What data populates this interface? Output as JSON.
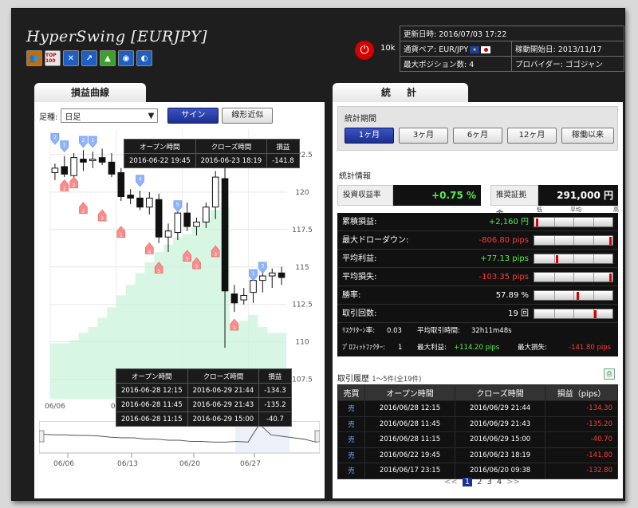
{
  "app": {
    "title": "HyperSwing [EURJPY]"
  },
  "header_icons": [
    {
      "name": "people-icon",
      "glyph": "👥",
      "color": "#c86c00"
    },
    {
      "name": "top100-icon",
      "glyph": "TOP 100",
      "color": "#e8e8e8"
    },
    {
      "name": "shuffle-icon",
      "glyph": "✕",
      "color": "#1e5fc4"
    },
    {
      "name": "chart-up-icon",
      "glyph": "↗",
      "color": "#1e5fc4"
    },
    {
      "name": "tree-icon",
      "glyph": "▲",
      "color": "#3aa12c"
    },
    {
      "name": "dial-icon",
      "glyph": "◉",
      "color": "#1e5fc4"
    },
    {
      "name": "globe-icon",
      "glyph": "◐",
      "color": "#1e5fc4"
    }
  ],
  "account": {
    "capital": "10k"
  },
  "info": {
    "updated_label": "更新日時:",
    "updated_value": "2016/07/03 17:22",
    "pair_label": "通貨ペア:",
    "pair_value": "EUR/JPY",
    "start_label": "稼動開始日:",
    "start_value": "2013/11/17",
    "maxpos_label": "最大ポジション数:",
    "maxpos_value": "4",
    "provider_label": "プロバイダー:",
    "provider_value": "ゴゴジャン"
  },
  "left": {
    "tab": "損益曲線",
    "period_label": "足種:",
    "period_value": "日足",
    "sign_button": "サイン",
    "trend_button": "線形近似",
    "tooltip_top": {
      "h1": "オープン時間",
      "h2": "クローズ時間",
      "h3": "損益",
      "open": "2016-06-22 19:45",
      "close": "2016-06-23 18:19",
      "pl": "-141.8"
    },
    "tooltip_bottom": {
      "h1": "オープン時間",
      "h2": "クローズ時間",
      "h3": "損益",
      "rows": [
        {
          "open": "2016-06-28 12:15",
          "close": "2016-06-29 21:44",
          "pl": "-134.3"
        },
        {
          "open": "2016-06-28 11:45",
          "close": "2016-06-29 21:43",
          "pl": "-135.2"
        },
        {
          "open": "2016-06-28 11:15",
          "close": "2016-06-29 15:00",
          "pl": "-40.7"
        }
      ]
    }
  },
  "chart_data": {
    "type": "candlestick",
    "title": "",
    "x_labels": [
      "06/06",
      "06/13",
      "06/20",
      "06/27"
    ],
    "y_ticks": [
      107.5,
      110,
      112.5,
      115,
      117.5,
      120,
      122.5
    ],
    "ylim": [
      106.2,
      124.2
    ],
    "grid": true,
    "candles": [
      {
        "o": 121.3,
        "h": 121.9,
        "l": 120.8,
        "c": 121.6
      },
      {
        "o": 121.7,
        "h": 122.4,
        "l": 121.0,
        "c": 121.2
      },
      {
        "o": 121.1,
        "h": 122.6,
        "l": 120.5,
        "c": 122.3
      },
      {
        "o": 122.2,
        "h": 122.8,
        "l": 121.4,
        "c": 122.0
      },
      {
        "o": 122.1,
        "h": 122.7,
        "l": 121.6,
        "c": 122.2
      },
      {
        "o": 122.3,
        "h": 122.9,
        "l": 121.8,
        "c": 122.0
      },
      {
        "o": 122.0,
        "h": 122.6,
        "l": 121.0,
        "c": 121.2
      },
      {
        "o": 121.3,
        "h": 121.6,
        "l": 119.4,
        "c": 119.7
      },
      {
        "o": 119.8,
        "h": 120.2,
        "l": 119.2,
        "c": 119.6
      },
      {
        "o": 119.6,
        "h": 120.1,
        "l": 118.8,
        "c": 119.0
      },
      {
        "o": 119.0,
        "h": 120.0,
        "l": 118.5,
        "c": 119.6
      },
      {
        "o": 119.5,
        "h": 119.9,
        "l": 116.6,
        "c": 117.0
      },
      {
        "o": 117.0,
        "h": 117.9,
        "l": 116.0,
        "c": 117.4
      },
      {
        "o": 117.3,
        "h": 118.8,
        "l": 116.8,
        "c": 118.6
      },
      {
        "o": 118.6,
        "h": 119.3,
        "l": 117.4,
        "c": 117.7
      },
      {
        "o": 117.7,
        "h": 118.3,
        "l": 117.1,
        "c": 118.0
      },
      {
        "o": 118.0,
        "h": 119.3,
        "l": 117.6,
        "c": 119.0
      },
      {
        "o": 119.0,
        "h": 121.4,
        "l": 118.2,
        "c": 121.0
      },
      {
        "o": 120.9,
        "h": 121.9,
        "l": 109.6,
        "c": 113.4
      },
      {
        "o": 113.2,
        "h": 113.8,
        "l": 112.0,
        "c": 112.6
      },
      {
        "o": 112.8,
        "h": 113.6,
        "l": 112.5,
        "c": 113.1
      },
      {
        "o": 113.3,
        "h": 114.4,
        "l": 112.6,
        "c": 114.1
      },
      {
        "o": 114.1,
        "h": 115.0,
        "l": 113.3,
        "c": 114.4
      },
      {
        "o": 114.4,
        "h": 114.9,
        "l": 113.6,
        "c": 114.6
      },
      {
        "o": 114.6,
        "h": 115.0,
        "l": 113.8,
        "c": 114.3
      }
    ],
    "equity_area_top": [
      109.9,
      109.9,
      110.1,
      110.6,
      111.0,
      111.6,
      112.3,
      113.1,
      113.8,
      114.6,
      115.3,
      116.0,
      116.5,
      117.0,
      117.2,
      117.6,
      118.3,
      118.8,
      119.0,
      111.2,
      111.4,
      111.8,
      111.0,
      110.6,
      110.6
    ],
    "signals": [
      {
        "i": 0,
        "y": 123.5,
        "kind": "buy",
        "label": "2"
      },
      {
        "i": 1,
        "y": 123.0,
        "kind": "buy",
        "label": "1"
      },
      {
        "i": 3,
        "y": 123.3,
        "kind": "buy",
        "label": "2"
      },
      {
        "i": 4,
        "y": 123.3,
        "kind": "buy",
        "label": "1"
      },
      {
        "i": 1,
        "y": 120.5,
        "kind": "sell",
        "label": "1"
      },
      {
        "i": 2,
        "y": 120.7,
        "kind": "sell",
        "label": "2"
      },
      {
        "i": 3,
        "y": 119.0,
        "kind": "sell",
        "label": "2"
      },
      {
        "i": 5,
        "y": 118.5,
        "kind": "sell",
        "label": "2"
      },
      {
        "i": 7,
        "y": 117.4,
        "kind": "sell",
        "label": "2"
      },
      {
        "i": 9,
        "y": 120.7,
        "kind": "buy",
        "label": "4"
      },
      {
        "i": 10,
        "y": 116.3,
        "kind": "sell",
        "label": "4"
      },
      {
        "i": 11,
        "y": 115.0,
        "kind": "sell",
        "label": "5"
      },
      {
        "i": 13,
        "y": 119.0,
        "kind": "buy",
        "label": "5"
      },
      {
        "i": 14,
        "y": 115.8,
        "kind": "sell",
        "label": "5"
      },
      {
        "i": 15,
        "y": 115.3,
        "kind": "sell",
        "label": "3"
      },
      {
        "i": 17,
        "y": 116.1,
        "kind": "sell",
        "label": "3"
      },
      {
        "i": 19,
        "y": 111.2,
        "kind": "sell",
        "label": "1"
      },
      {
        "i": 21,
        "y": 114.4,
        "kind": "buy",
        "label": "1"
      },
      {
        "i": 22,
        "y": 114.9,
        "kind": "buy",
        "label": "3"
      }
    ],
    "nav_series": [
      0.62,
      0.6,
      0.6,
      0.58,
      0.58,
      0.56,
      0.52,
      0.5,
      0.5,
      0.46,
      0.46,
      0.42,
      0.42,
      0.38,
      0.38,
      0.36,
      0.36,
      0.38,
      0.36,
      0.95,
      0.6,
      0.55,
      0.5,
      0.45,
      0.35
    ]
  },
  "right": {
    "tab": "統　計",
    "period_title": "統計期間",
    "period_buttons": [
      "1ヶ月",
      "3ヶ月",
      "6ヶ月",
      "12ヶ月",
      "稼働以来"
    ],
    "stat_title": "統計情報",
    "roi_label": "投資収益率",
    "roi_value": "+0.75 %",
    "margin_label": "推奨証拠金",
    "margin_value": "291,000 円",
    "scale_low": "低",
    "scale_mid": "平均",
    "scale_high": "高",
    "stats": [
      {
        "label": "累積損益:",
        "value": "+2,160 円",
        "color": "green",
        "marker": 0.02
      },
      {
        "label": "最大ドローダウン:",
        "value": "-806.80 pips",
        "color": "red",
        "marker": 0.98
      },
      {
        "label": "平均利益:",
        "value": "+77.13 pips",
        "color": "green",
        "marker": 0.28
      },
      {
        "label": "平均損失:",
        "value": "-103.35 pips",
        "color": "red",
        "marker": 0.98
      },
      {
        "label": "勝率:",
        "value": "57.89 %",
        "color": "white",
        "marker": 0.55
      },
      {
        "label": "取引回数:",
        "value": "19 回",
        "color": "white",
        "marker": 0.78
      }
    ],
    "extra1": {
      "rr_label": "ﾘｽｸﾘﾀｰﾝ率:",
      "rr_value": "0.03",
      "avg_label": "平均取引時間:",
      "avg_value": "32h11m48s"
    },
    "extra2": {
      "pf_label": "ﾌﾟﾛﾌｨｯﾄﾌｧｸﾀｰ:",
      "pf_value": "1",
      "maxwin_label": "最大利益:",
      "maxwin_value": "+114.20 pips",
      "maxloss_label": "最大損失:",
      "maxloss_value": "-141.80 pips"
    },
    "history_title": "取引履歴",
    "history_sub": "1～5件(全19件)",
    "history_headers": [
      "売買",
      "オープン時間",
      "クローズ時間",
      "損益（pips）"
    ],
    "history": [
      {
        "side": "売",
        "open": "2016/06/28 12:15",
        "close": "2016/06/29 21:44",
        "pl": "-134.30"
      },
      {
        "side": "売",
        "open": "2016/06/28 11:45",
        "close": "2016/06/29 21:43",
        "pl": "-135.20"
      },
      {
        "side": "売",
        "open": "2016/06/28 11:15",
        "close": "2016/06/29 15:00",
        "pl": "-40.70"
      },
      {
        "side": "売",
        "open": "2016/06/22 19:45",
        "close": "2016/06/23 18:19",
        "pl": "-141.80"
      },
      {
        "side": "売",
        "open": "2016/06/17 23:15",
        "close": "2016/06/20 09:38",
        "pl": "-132.80"
      }
    ],
    "pager": {
      "prev": "<<",
      "pages": [
        "1",
        "2",
        "3",
        "4"
      ],
      "next": ">>"
    }
  },
  "colors": {
    "accent": "#1d2f8f",
    "profit": "#56f04e",
    "loss": "#ff3a3a",
    "buy_signal": "#8fb4ff",
    "sell_signal": "#ff8a8a",
    "equity": "#c6f3d9"
  }
}
